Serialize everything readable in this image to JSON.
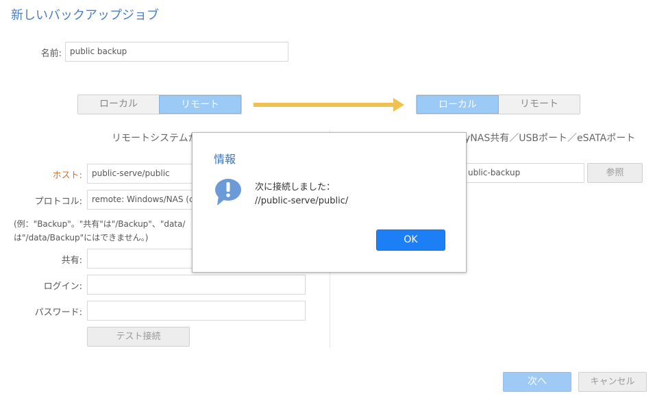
{
  "title": "新しいバックアップジョブ",
  "name_field": {
    "label": "名前:",
    "value": "public backup"
  },
  "source_toggle": {
    "local": "ローカル",
    "remote": "リモート",
    "selected": "remote"
  },
  "dest_toggle": {
    "local": "ローカル",
    "remote": "リモート",
    "selected": "local"
  },
  "left_subtitle": "リモートシステムか",
  "right_subtitle": "yNAS共有／USBポート／eSATAポート",
  "host": {
    "label": "ホスト:",
    "value": "public-serve/public"
  },
  "protocol": {
    "label": "プロトコル:",
    "value": "remote: Windows/NAS (c"
  },
  "note": {
    "line1": "(例：\"Backup\"。\"共有\"は\"/Backup\"、\"data/",
    "line2": "は\"/data/Backup\"にはできません。)"
  },
  "share": {
    "label": "共有:",
    "value": ""
  },
  "login": {
    "label": "ログイン:",
    "value": ""
  },
  "password": {
    "label": "パスワード:",
    "value": ""
  },
  "test_button": "テスト接続",
  "dest_path": {
    "value": "ublic-backup"
  },
  "browse_button": "参照",
  "next_button": "次へ",
  "cancel_button": "キャンセル",
  "dialog": {
    "title": "情報",
    "message_line1": "次に接続しました：",
    "message_line2": "//public-serve/public/",
    "ok": "OK"
  },
  "colors": {
    "accent": "#4a7fc1",
    "toggle_on": "#9ccaf7",
    "arrow": "#f0c050",
    "ok_button": "#1d7ff6",
    "warn_label": "#d07030"
  }
}
